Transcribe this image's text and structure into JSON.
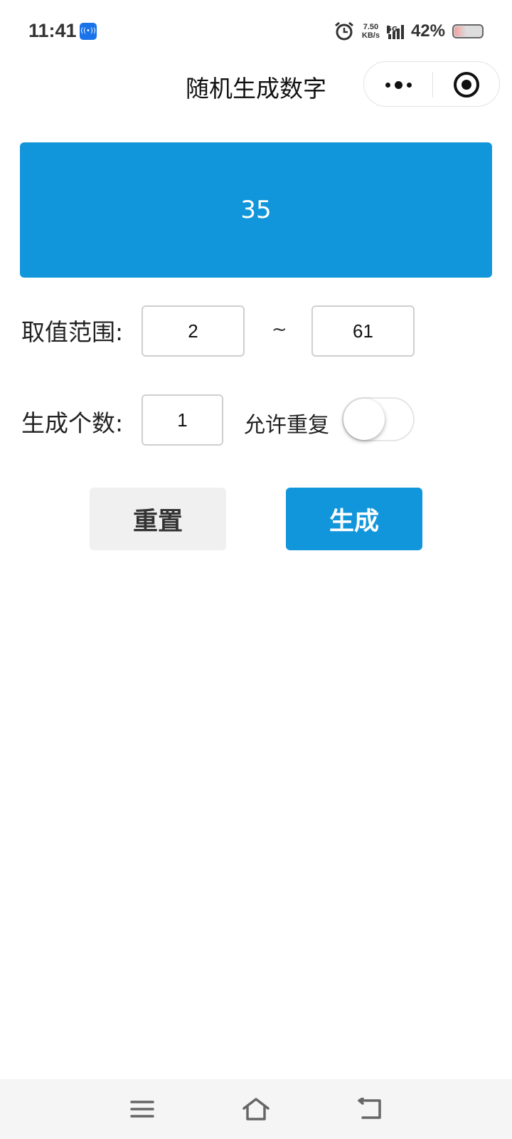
{
  "status_bar": {
    "time": "11:41",
    "net_speed_value": "7.50",
    "net_speed_unit": "KB/s",
    "network": "5G",
    "battery": "42%",
    "battery_level": 0.42
  },
  "nav": {
    "title": "随机生成数字"
  },
  "result": {
    "value": "35"
  },
  "range": {
    "label": "取值范围:",
    "min": "2",
    "separator": "~",
    "max": "61"
  },
  "count": {
    "label": "生成个数:",
    "value": "1",
    "allow_repeat_label": "允许重复",
    "allow_repeat": false
  },
  "buttons": {
    "reset_label": "重置",
    "generate_label": "生成"
  },
  "colors": {
    "accent": "#1296db",
    "reset_bg": "#f0f0f0"
  },
  "icons": {
    "hotspot": "hotspot-icon",
    "alarm": "alarm-icon",
    "more": "more-dots-icon",
    "close": "target-icon",
    "menu": "menu-icon",
    "home": "home-icon",
    "back": "back-icon"
  }
}
